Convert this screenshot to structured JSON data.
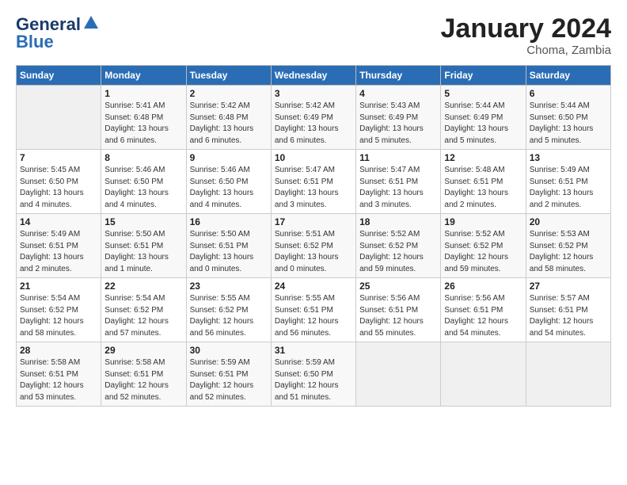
{
  "header": {
    "logo_line1": "General",
    "logo_line2": "Blue",
    "month": "January 2024",
    "location": "Choma, Zambia"
  },
  "weekdays": [
    "Sunday",
    "Monday",
    "Tuesday",
    "Wednesday",
    "Thursday",
    "Friday",
    "Saturday"
  ],
  "weeks": [
    [
      {
        "num": "",
        "info": ""
      },
      {
        "num": "1",
        "info": "Sunrise: 5:41 AM\nSunset: 6:48 PM\nDaylight: 13 hours\nand 6 minutes."
      },
      {
        "num": "2",
        "info": "Sunrise: 5:42 AM\nSunset: 6:48 PM\nDaylight: 13 hours\nand 6 minutes."
      },
      {
        "num": "3",
        "info": "Sunrise: 5:42 AM\nSunset: 6:49 PM\nDaylight: 13 hours\nand 6 minutes."
      },
      {
        "num": "4",
        "info": "Sunrise: 5:43 AM\nSunset: 6:49 PM\nDaylight: 13 hours\nand 5 minutes."
      },
      {
        "num": "5",
        "info": "Sunrise: 5:44 AM\nSunset: 6:49 PM\nDaylight: 13 hours\nand 5 minutes."
      },
      {
        "num": "6",
        "info": "Sunrise: 5:44 AM\nSunset: 6:50 PM\nDaylight: 13 hours\nand 5 minutes."
      }
    ],
    [
      {
        "num": "7",
        "info": "Sunrise: 5:45 AM\nSunset: 6:50 PM\nDaylight: 13 hours\nand 4 minutes."
      },
      {
        "num": "8",
        "info": "Sunrise: 5:46 AM\nSunset: 6:50 PM\nDaylight: 13 hours\nand 4 minutes."
      },
      {
        "num": "9",
        "info": "Sunrise: 5:46 AM\nSunset: 6:50 PM\nDaylight: 13 hours\nand 4 minutes."
      },
      {
        "num": "10",
        "info": "Sunrise: 5:47 AM\nSunset: 6:51 PM\nDaylight: 13 hours\nand 3 minutes."
      },
      {
        "num": "11",
        "info": "Sunrise: 5:47 AM\nSunset: 6:51 PM\nDaylight: 13 hours\nand 3 minutes."
      },
      {
        "num": "12",
        "info": "Sunrise: 5:48 AM\nSunset: 6:51 PM\nDaylight: 13 hours\nand 2 minutes."
      },
      {
        "num": "13",
        "info": "Sunrise: 5:49 AM\nSunset: 6:51 PM\nDaylight: 13 hours\nand 2 minutes."
      }
    ],
    [
      {
        "num": "14",
        "info": "Sunrise: 5:49 AM\nSunset: 6:51 PM\nDaylight: 13 hours\nand 2 minutes."
      },
      {
        "num": "15",
        "info": "Sunrise: 5:50 AM\nSunset: 6:51 PM\nDaylight: 13 hours\nand 1 minute."
      },
      {
        "num": "16",
        "info": "Sunrise: 5:50 AM\nSunset: 6:51 PM\nDaylight: 13 hours\nand 0 minutes."
      },
      {
        "num": "17",
        "info": "Sunrise: 5:51 AM\nSunset: 6:52 PM\nDaylight: 13 hours\nand 0 minutes."
      },
      {
        "num": "18",
        "info": "Sunrise: 5:52 AM\nSunset: 6:52 PM\nDaylight: 12 hours\nand 59 minutes."
      },
      {
        "num": "19",
        "info": "Sunrise: 5:52 AM\nSunset: 6:52 PM\nDaylight: 12 hours\nand 59 minutes."
      },
      {
        "num": "20",
        "info": "Sunrise: 5:53 AM\nSunset: 6:52 PM\nDaylight: 12 hours\nand 58 minutes."
      }
    ],
    [
      {
        "num": "21",
        "info": "Sunrise: 5:54 AM\nSunset: 6:52 PM\nDaylight: 12 hours\nand 58 minutes."
      },
      {
        "num": "22",
        "info": "Sunrise: 5:54 AM\nSunset: 6:52 PM\nDaylight: 12 hours\nand 57 minutes."
      },
      {
        "num": "23",
        "info": "Sunrise: 5:55 AM\nSunset: 6:52 PM\nDaylight: 12 hours\nand 56 minutes."
      },
      {
        "num": "24",
        "info": "Sunrise: 5:55 AM\nSunset: 6:51 PM\nDaylight: 12 hours\nand 56 minutes."
      },
      {
        "num": "25",
        "info": "Sunrise: 5:56 AM\nSunset: 6:51 PM\nDaylight: 12 hours\nand 55 minutes."
      },
      {
        "num": "26",
        "info": "Sunrise: 5:56 AM\nSunset: 6:51 PM\nDaylight: 12 hours\nand 54 minutes."
      },
      {
        "num": "27",
        "info": "Sunrise: 5:57 AM\nSunset: 6:51 PM\nDaylight: 12 hours\nand 54 minutes."
      }
    ],
    [
      {
        "num": "28",
        "info": "Sunrise: 5:58 AM\nSunset: 6:51 PM\nDaylight: 12 hours\nand 53 minutes."
      },
      {
        "num": "29",
        "info": "Sunrise: 5:58 AM\nSunset: 6:51 PM\nDaylight: 12 hours\nand 52 minutes."
      },
      {
        "num": "30",
        "info": "Sunrise: 5:59 AM\nSunset: 6:51 PM\nDaylight: 12 hours\nand 52 minutes."
      },
      {
        "num": "31",
        "info": "Sunrise: 5:59 AM\nSunset: 6:50 PM\nDaylight: 12 hours\nand 51 minutes."
      },
      {
        "num": "",
        "info": ""
      },
      {
        "num": "",
        "info": ""
      },
      {
        "num": "",
        "info": ""
      }
    ]
  ]
}
